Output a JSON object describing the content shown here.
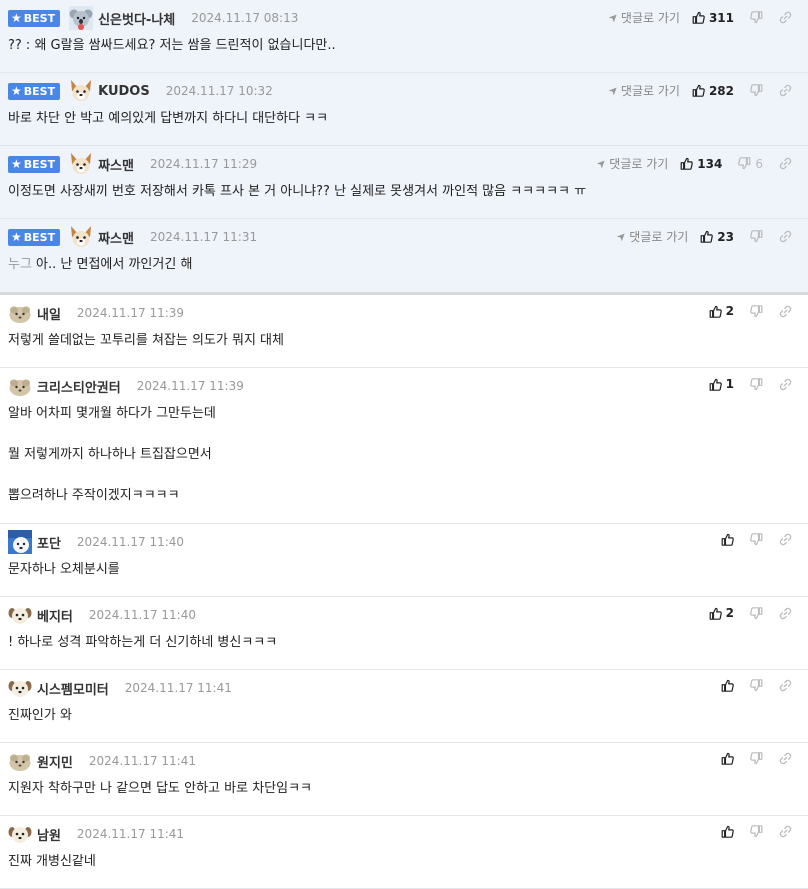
{
  "badge_label": "BEST",
  "goto_label": "댓글로 가기",
  "colors": {
    "best_bg": "#eff3fa",
    "badge": "#4a86e8"
  },
  "comments": [
    {
      "best": true,
      "avatar": "koala",
      "nick": "신은벗다-나체",
      "date": "2024.11.17 08:13",
      "goto": true,
      "likes": "311",
      "dislikes": "",
      "paragraphs": [
        "?? : 왜 G랄을 쌈싸드세요? 저는 쌈을 드린적이 없습니다만.."
      ]
    },
    {
      "best": true,
      "avatar": "dog",
      "nick": "KUDOS",
      "date": "2024.11.17 10:32",
      "goto": true,
      "likes": "282",
      "dislikes": "",
      "paragraphs": [
        "바로 차단 안 박고 예의있게 답변까지 하다니 대단하다 ㅋㅋ"
      ]
    },
    {
      "best": true,
      "avatar": "dog",
      "nick": "짜스맨",
      "date": "2024.11.17 11:29",
      "goto": true,
      "likes": "134",
      "dislikes": "6",
      "paragraphs": [
        "이정도면 사장새끼 번호 저장해서 카톡 프사 본 거 아니냐?? 난 실제로 못생겨서 까인적 많음 ㅋㅋㅋㅋㅋ ㅠ"
      ]
    },
    {
      "best": true,
      "avatar": "dog",
      "nick": "짜스맨",
      "date": "2024.11.17 11:31",
      "goto": true,
      "likes": "23",
      "dislikes": "",
      "quote": "누그",
      "paragraphs": [
        " 아.. 난 면접에서 까인거긴 해"
      ]
    },
    {
      "best": false,
      "avatar": "blob",
      "nick": "내일",
      "date": "2024.11.17 11:39",
      "likes": "2",
      "dislikes": "",
      "paragraphs": [
        "저렇게 쓸데없는 꼬투리를 쳐잡는 의도가 뭐지 대체"
      ]
    },
    {
      "best": false,
      "avatar": "blob",
      "nick": "크리스티안권터",
      "date": "2024.11.17 11:39",
      "likes": "1",
      "dislikes": "",
      "paragraphs": [
        "알바 어차피 몇개월 하다가 그만두는데",
        "뭘 저렇게까지 하나하나 트집잡으면서",
        "뽑으려하나 주작이겠지ㅋㅋㅋㅋ"
      ]
    },
    {
      "best": false,
      "avatar": "bear",
      "nick": "포단",
      "date": "2024.11.17 11:40",
      "likes": "",
      "dislikes": "",
      "paragraphs": [
        "문자하나 오체분시를"
      ]
    },
    {
      "best": false,
      "avatar": "puppy",
      "nick": "베지터",
      "date": "2024.11.17 11:40",
      "likes": "2",
      "dislikes": "",
      "paragraphs": [
        "! 하나로 성격 파악하는게 더 신기하네 병신ㅋㅋㅋ"
      ]
    },
    {
      "best": false,
      "avatar": "puppy",
      "nick": "시스펨모미터",
      "date": "2024.11.17 11:41",
      "likes": "",
      "dislikes": "",
      "paragraphs": [
        "진짜인가 와"
      ]
    },
    {
      "best": false,
      "avatar": "blob",
      "nick": "원지민",
      "date": "2024.11.17 11:41",
      "likes": "",
      "dislikes": "",
      "paragraphs": [
        "지원자 착하구만 나 같으면 답도 안하고 바로 차단임ㅋㅋ"
      ]
    },
    {
      "best": false,
      "avatar": "puppy",
      "nick": "남원",
      "date": "2024.11.17 11:41",
      "likes": "",
      "dislikes": "",
      "paragraphs": [
        "진짜 개병신같네"
      ]
    }
  ]
}
